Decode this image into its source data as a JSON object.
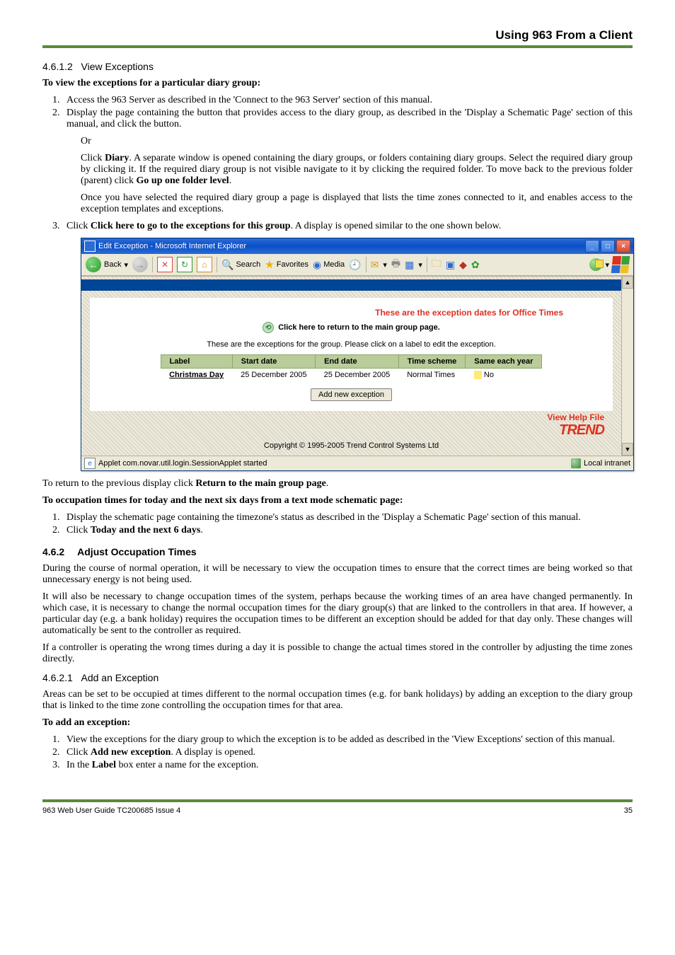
{
  "header": {
    "title": "Using 963 From a Client"
  },
  "s1": {
    "num": "4.6.1.2",
    "title": "View Exceptions",
    "intro": "To view the exceptions for a particular diary group:",
    "step1": "Access the 963 Server as described in the 'Connect to the 963 Server' section of this manual.",
    "step2": "Display the page containing the button that provides access to the diary group, as described in the 'Display a Schematic Page' section of this manual, and click the button.",
    "or": "Or",
    "p1a": "Click ",
    "p1b": "Diary",
    "p1c": ". A separate window is opened containing the diary groups, or folders containing diary groups. Select the required diary group by clicking it. If the required diary group is not visible navigate to it by clicking the required folder. To move back to the previous folder (parent) click ",
    "p1d": "Go up one folder level",
    "p1e": ".",
    "p2": "Once you have selected the required diary group a page is displayed that lists the time zones connected to it, and enables access to the exception templates and exceptions.",
    "step3a": "Click ",
    "step3b": "Click here to go to the exceptions for this group",
    "step3c": ". A display is opened similar to the one shown below."
  },
  "ie": {
    "title": "Edit Exception - Microsoft Internet Explorer",
    "back": "Back",
    "search": "Search",
    "favorites": "Favorites",
    "media": "Media",
    "heading": "These are the exception dates for Office Times",
    "clickline": "Click here to return to the main group page.",
    "note": "These are the exceptions for the group. Please click on a label to edit the exception.",
    "cols": {
      "c1": "Label",
      "c2": "Start date",
      "c3": "End date",
      "c4": "Time scheme",
      "c5": "Same each year"
    },
    "row": {
      "c1": "Christmas Day",
      "c2": "25 December 2005",
      "c3": "25 December 2005",
      "c4": "Normal Times",
      "c5": "No"
    },
    "addbtn": "Add new exception",
    "viewhelp": "View Help File",
    "trend": "TREND",
    "copyright": "Copyright © 1995-2005 Trend Control Systems Ltd",
    "status_left": "Applet com.novar.util.login.SessionApplet started",
    "status_right": "Local intranet"
  },
  "after1a": "To return to the previous display click ",
  "after1b": "Return to the main group page",
  "after1c": ".",
  "occ": {
    "intro": "To occupation times for today and the next six days from a text mode schematic page:",
    "s1": "Display the schematic page containing the timezone's status as described in the 'Display a Schematic Page' section of this manual.",
    "s2a": "Click ",
    "s2b": "Today and the next 6 days",
    "s2c": "."
  },
  "s2": {
    "num": "4.6.2",
    "title": "Adjust Occupation Times",
    "p1": "During the course of normal operation, it will be necessary to view the occupation times to ensure that the correct times are being worked so that unnecessary energy is not being used.",
    "p2": "It will also be necessary to change occupation times of the system, perhaps because the working times of an area have changed permanently. In which case, it is necessary to change the normal occupation times for the diary group(s) that are linked to the controllers in that area. If however, a particular day (e.g. a bank holiday) requires the occupation times to be different an exception should be added for that day only. These changes will automatically be sent to the controller as required.",
    "p3": "If a controller is operating the wrong times during a day it is possible to change the actual times stored in the controller by adjusting the time zones directly."
  },
  "s3": {
    "num": "4.6.2.1",
    "title": "Add an Exception",
    "p1": "Areas can be set to be occupied at times different to the normal occupation times (e.g. for bank holidays) by adding an exception to the diary group that is linked to the time zone controlling the occupation times for that area.",
    "intro": "To add an exception:",
    "s1": "View the exceptions for the diary group to which the exception is to be added as described in the 'View Exceptions' section of this manual.",
    "s2a": "Click ",
    "s2b": "Add new exception",
    "s2c": ". A display is opened.",
    "s3a": "In the ",
    "s3b": "Label",
    "s3c": " box enter a name for the exception."
  },
  "footer": {
    "left": "963 Web User Guide TC200685 Issue 4",
    "right": "35"
  }
}
